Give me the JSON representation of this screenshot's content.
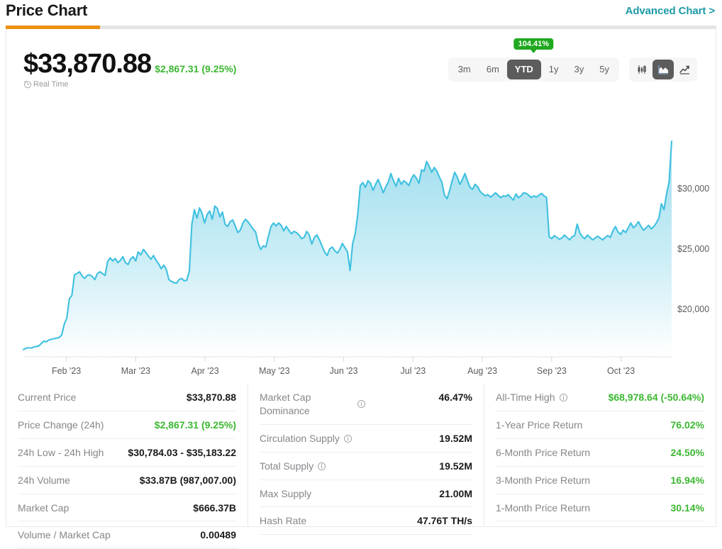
{
  "header": {
    "title": "Price Chart",
    "advanced_link": "Advanced Chart >",
    "accent_color": "#ec9013",
    "link_color": "#1b9aa6"
  },
  "price": {
    "current": "$33,870.88",
    "delta": "$2,867.31 (9.25%)",
    "delta_color": "#3cb832",
    "realtime_label": "Real Time",
    "clock_icon": "clock-icon"
  },
  "controls": {
    "badge": "104.41%",
    "badge_color": "#20a81e",
    "ranges": [
      {
        "label": "3m",
        "active": false
      },
      {
        "label": "6m",
        "active": false
      },
      {
        "label": "YTD",
        "active": true
      },
      {
        "label": "1y",
        "active": false
      },
      {
        "label": "3y",
        "active": false
      },
      {
        "label": "5y",
        "active": false
      }
    ],
    "chart_types": [
      {
        "icon": "candlestick-icon",
        "active": false
      },
      {
        "icon": "area-chart-icon",
        "active": true
      },
      {
        "icon": "line-chart-icon",
        "active": false
      }
    ]
  },
  "chart_data": {
    "type": "area",
    "title": "Price Chart",
    "xlabel": "",
    "ylabel": "",
    "grid": false,
    "legend": "none",
    "line_color": "#3fc0e0",
    "fill_top_color": "#a9e0ee",
    "fill_bottom_color": "#ffffff",
    "ylim": [
      16000,
      36000
    ],
    "yticks": [
      20000,
      25000,
      30000
    ],
    "ytick_labels": [
      "$20,000",
      "$25,000",
      "$30,000"
    ],
    "xticks": [
      "Feb '23",
      "Mar '23",
      "Apr '23",
      "May '23",
      "Jun '23",
      "Jul '23",
      "Aug '23",
      "Sep '23",
      "Oct '23"
    ],
    "xlim": [
      "Jan '23",
      "Nov '23"
    ],
    "values": [
      16600,
      16700,
      16750,
      16720,
      16800,
      16850,
      16900,
      17100,
      17300,
      17250,
      17400,
      17450,
      17500,
      17550,
      17600,
      17800,
      18700,
      19200,
      20800,
      21100,
      22800,
      22900,
      23050,
      22700,
      22500,
      22750,
      22800,
      22650,
      22400,
      22900,
      23050,
      22900,
      22750,
      23900,
      24200,
      23950,
      24150,
      23800,
      24000,
      24300,
      23800,
      23650,
      24100,
      24300,
      23950,
      24700,
      24450,
      24900,
      24650,
      24350,
      24100,
      24400,
      24000,
      23700,
      23300,
      23600,
      23250,
      22400,
      22250,
      22150,
      22100,
      22400,
      22500,
      22300,
      22350,
      23100,
      27000,
      28200,
      27500,
      28350,
      27900,
      27100,
      27800,
      28100,
      27400,
      28500,
      28300,
      27600,
      28000,
      27000,
      26800,
      27200,
      27350,
      26850,
      26300,
      26500,
      27100,
      27400,
      27200,
      26900,
      26600,
      26350,
      25400,
      24900,
      25200,
      25100,
      26000,
      26800,
      27100,
      26850,
      27100,
      26900,
      26450,
      26800,
      26500,
      26200,
      26400,
      26300,
      26100,
      25800,
      25900,
      26400,
      26100,
      25350,
      25900,
      26100,
      25700,
      25200,
      24700,
      24400,
      24950,
      25100,
      24800,
      24600,
      24900,
      25400,
      25050,
      24700,
      23150,
      25400,
      26200,
      27800,
      30200,
      30450,
      30050,
      30600,
      30400,
      29800,
      30300,
      30700,
      30200,
      29600,
      30100,
      30500,
      31200,
      30600,
      30150,
      30800,
      30300,
      30600,
      30450,
      30200,
      30750,
      31100,
      30800,
      30400,
      31500,
      31400,
      32200,
      31800,
      31300,
      31700,
      31400,
      30900,
      30450,
      29400,
      29100,
      29800,
      30600,
      31300,
      30900,
      30300,
      30700,
      31200,
      30600,
      30050,
      29900,
      30300,
      30100,
      29700,
      29500,
      29350,
      29450,
      29250,
      29400,
      29600,
      29400,
      29200,
      29350,
      29300,
      29450,
      29200,
      29000,
      29500,
      29200,
      29350,
      29600,
      29550,
      29400,
      29200,
      29350,
      29250,
      29400,
      29550,
      29350,
      29200,
      25950,
      25800,
      26050,
      25900,
      25750,
      25850,
      26100,
      25900,
      25700,
      25950,
      26050,
      27000,
      26300,
      25950,
      25800,
      26100,
      25900,
      25700,
      25850,
      26000,
      25850,
      25700,
      25900,
      26050,
      25900,
      26450,
      26800,
      26350,
      26150,
      26500,
      26300,
      26700,
      27100,
      26700,
      26900,
      27200,
      26800,
      26500,
      26700,
      26900,
      26600,
      26800,
      27100,
      27500,
      28700,
      28200,
      29500,
      30500,
      33870
    ]
  },
  "stats": {
    "column_1": [
      {
        "label": "Current Price",
        "value": "$33,870.88",
        "green": false,
        "info": false
      },
      {
        "label": "Price Change (24h)",
        "value": "$2,867.31 (9.25%)",
        "green": true,
        "info": false
      },
      {
        "label": "24h Low - 24h High",
        "value": "$30,784.03 - $35,183.22",
        "green": false,
        "info": false
      },
      {
        "label": "24h Volume",
        "value": "$33.87B (987,007.00)",
        "green": false,
        "info": false
      },
      {
        "label": "Market Cap",
        "value": "$666.37B",
        "green": false,
        "info": false
      },
      {
        "label": "Volume / Market Cap",
        "value": "0.00489",
        "green": false,
        "info": false
      }
    ],
    "column_2": [
      {
        "label": "Market Cap Dominance",
        "value": "46.47%",
        "green": false,
        "info": true
      },
      {
        "label": "Circulation Supply",
        "value": "19.52M",
        "green": false,
        "info": true
      },
      {
        "label": "Total Supply",
        "value": "19.52M",
        "green": false,
        "info": true
      },
      {
        "label": "Max Supply",
        "value": "21.00M",
        "green": false,
        "info": false
      },
      {
        "label": "Hash Rate",
        "value": "47.76T TH/s",
        "green": false,
        "info": false
      }
    ],
    "column_3": [
      {
        "label": "All-Time High",
        "value": "$68,978.64 (-50.64%)",
        "green": true,
        "info": true
      },
      {
        "label": "1-Year Price Return",
        "value": "76.02%",
        "green": true,
        "info": false
      },
      {
        "label": "6-Month Price Return",
        "value": "24.50%",
        "green": true,
        "info": false
      },
      {
        "label": "3-Month Price Return",
        "value": "16.94%",
        "green": true,
        "info": false
      },
      {
        "label": "1-Month Price Return",
        "value": "30.14%",
        "green": true,
        "info": false
      }
    ]
  }
}
